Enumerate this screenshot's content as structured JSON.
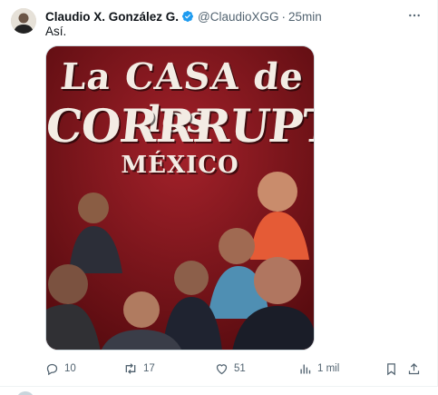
{
  "tweet": {
    "author_name": "Claudio X. González G.",
    "handle": "@ClaudioXGG",
    "separator": "·",
    "time": "25min",
    "text": "Así.",
    "verified_color": "#1d9bf0",
    "icons": {
      "avatar": "avatar",
      "verified": "verified-badge-icon",
      "more": "more-icon"
    }
  },
  "media": {
    "poster_line1": "La CASA de los",
    "poster_line2": "CORRRUPTOS",
    "poster_line3": "MÉXICO",
    "background_color": "#7c1418"
  },
  "actions": {
    "reply_count": "10",
    "retweet_count": "17",
    "like_count": "51",
    "views_count": "1 mil",
    "icon_color": "#536471",
    "icons": {
      "reply": "reply-icon",
      "retweet": "retweet-icon",
      "like": "heart-icon",
      "views": "views-icon",
      "bookmark": "bookmark-icon",
      "share": "share-icon"
    }
  }
}
